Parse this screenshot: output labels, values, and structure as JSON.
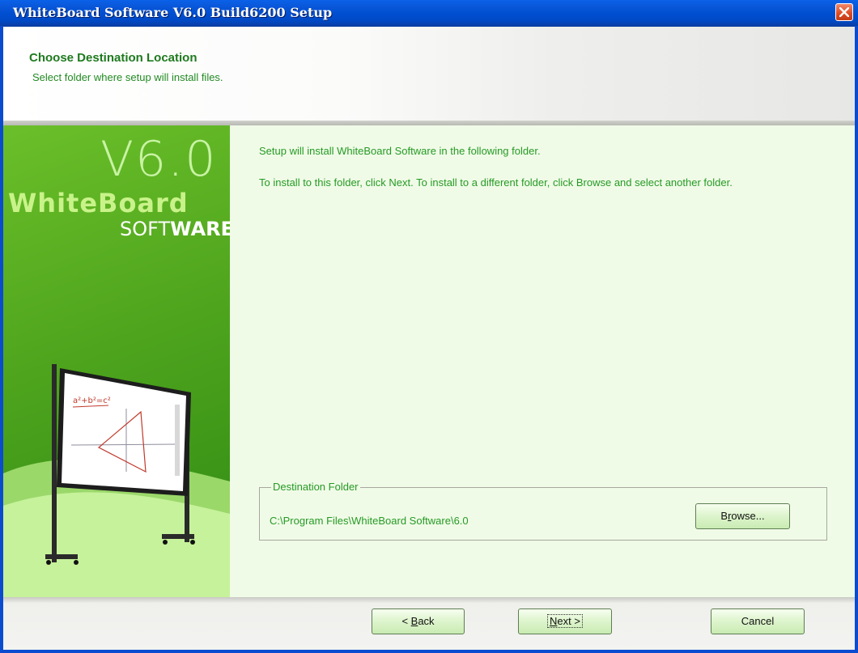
{
  "window": {
    "title": "WhiteBoard Software V6.0 Build6200 Setup"
  },
  "header": {
    "title": "Choose Destination Location",
    "subtitle": "Select folder where setup will install files."
  },
  "banner": {
    "version": "V6.0",
    "brand_line1": "WhiteBoard",
    "brand_soft": "SOFT",
    "brand_ware": "WARE"
  },
  "content": {
    "line1": "Setup will install WhiteBoard Software in the following folder.",
    "line2": "To install to this folder, click Next. To install to a different folder, click Browse and select another folder.",
    "group_label": "Destination Folder",
    "folder_path": "C:\\Program Files\\WhiteBoard Software\\6.0",
    "browse_pre": "B",
    "browse_u": "r",
    "browse_post": "owse..."
  },
  "footer": {
    "back_pre": "< ",
    "back_u": "B",
    "back_post": "ack",
    "next_u": "N",
    "next_post": "ext >",
    "cancel": "Cancel"
  },
  "colors": {
    "titlebar": "#0a57da",
    "accent_green": "#269a26",
    "content_bg": "#f0fbe7"
  }
}
